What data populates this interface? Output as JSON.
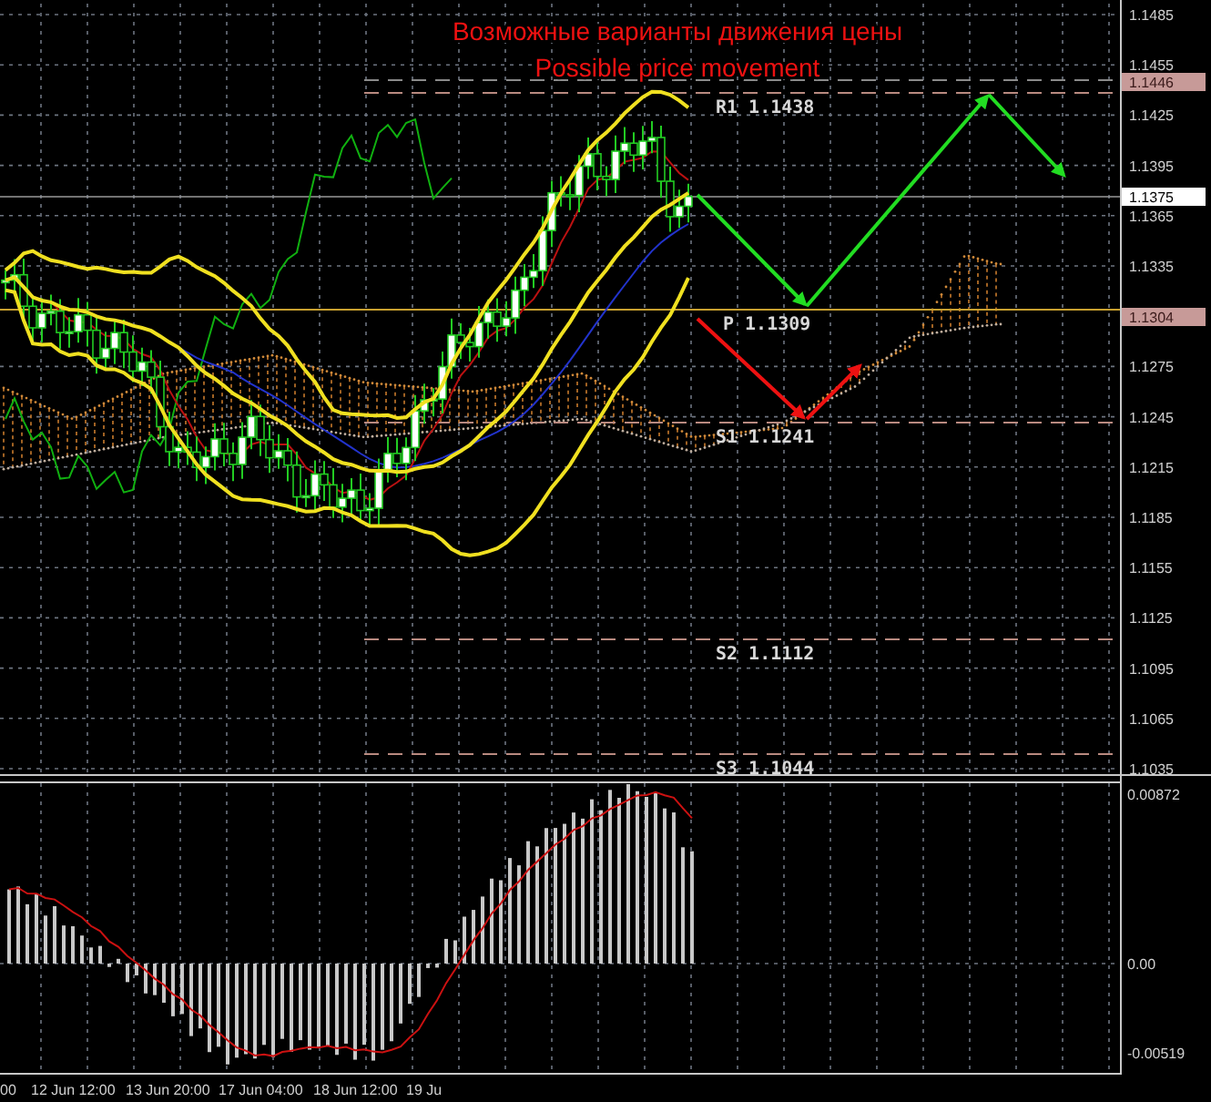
{
  "title": {
    "line_ru": "Возможные варианты движения цены",
    "line_en": "Possible price movement"
  },
  "price_axis": {
    "ticks": [
      "1.1485",
      "1.1455",
      "1.1425",
      "1.1395",
      "1.1365",
      "1.1335",
      "1.1275",
      "1.1245",
      "1.1215",
      "1.1185",
      "1.1155",
      "1.1125",
      "1.1095",
      "1.1065",
      "1.1035"
    ]
  },
  "price_tags": [
    {
      "text": "1.1446",
      "kind": "level"
    },
    {
      "text": "1.1375",
      "kind": "last"
    },
    {
      "text": "1.1304",
      "kind": "level"
    }
  ],
  "levels": [
    {
      "label": "R1 1.1438"
    },
    {
      "label": "P 1.1309"
    },
    {
      "label": "S1 1.1241"
    },
    {
      "label": "S2 1.1112"
    },
    {
      "label": "S3 1.1044"
    }
  ],
  "oscillator_axis": {
    "ticks": [
      "0.00872",
      "0.00",
      "-0.00519"
    ]
  },
  "time_axis": {
    "labels": [
      "00",
      "12 Jun 12:00",
      "13 Jun 20:00",
      "17 Jun 04:00",
      "18 Jun 12:00",
      "19 Ju"
    ]
  }
}
